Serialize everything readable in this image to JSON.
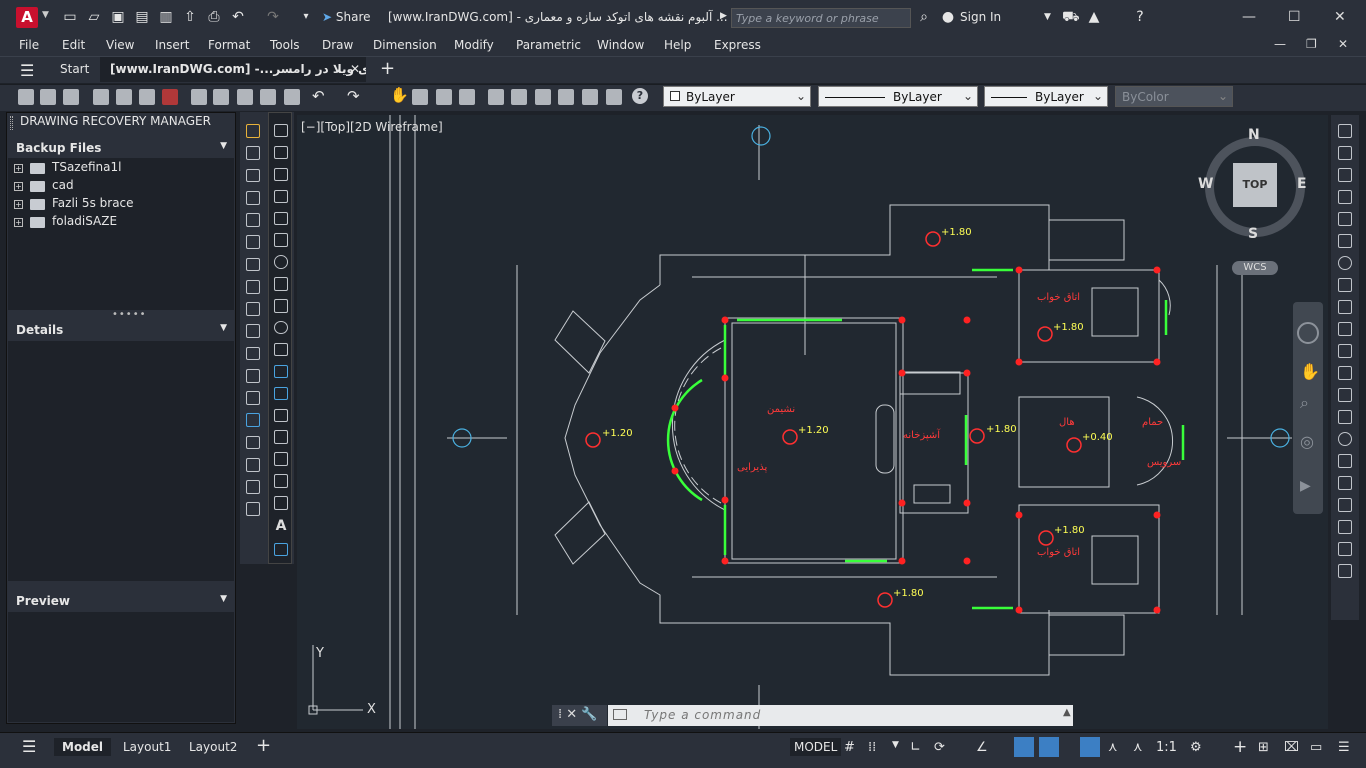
{
  "title_bar": {
    "logo": "A",
    "share_label": "Share",
    "window_title": "[www.IranDWG.com] - آلبوم نقشه های اتوکد سازه و معماری ...",
    "search_placeholder": "Type a keyword or phrase",
    "sign_in": "Sign In"
  },
  "menu": [
    "File",
    "Edit",
    "View",
    "Insert",
    "Format",
    "Tools",
    "Draw",
    "Dimension",
    "Modify",
    "Parametric",
    "Window",
    "Help",
    "Express"
  ],
  "tabs": {
    "start": "Start",
    "doc": "[www.IranDWG.com] -...مارى ويلا در رامسر*"
  },
  "properties": {
    "color": "ByLayer",
    "linetype": "ByLayer",
    "lineweight": "ByLayer",
    "plotstyle": "ByColor"
  },
  "recovery": {
    "title": "DRAWING RECOVERY MANAGER",
    "backup_label": "Backup Files",
    "files": [
      "TSazefina1l",
      "cad",
      "Fazli 5s brace",
      "foladiSAZE"
    ],
    "details_label": "Details",
    "preview_label": "Preview"
  },
  "view": {
    "label": "[−][Top][2D Wireframe]",
    "compass": {
      "n": "N",
      "s": "S",
      "e": "E",
      "w": "W",
      "top": "TOP"
    },
    "wcs": "WCS",
    "ucs_x": "X",
    "ucs_y": "Y"
  },
  "plan": {
    "elev_1": "+1.80",
    "elev_2": "+1.20",
    "elev_3": "+1.20",
    "elev_4": "+1.80",
    "elev_5": "+1.80",
    "elev_6": "+0.40",
    "elev_7": "+1.80",
    "elev_8": "+1.80",
    "room_living": "پذیرایی",
    "room_dining": "نشیمن",
    "room_kitchen": "آشپزخانه",
    "room_bed1": "اتاق خواب",
    "room_bed2": "اتاق خواب",
    "room_bath": "حمام",
    "room_wc": "سرویس",
    "room_hall": "هال"
  },
  "command": {
    "placeholder": "Type  a  command"
  },
  "layouts": [
    "Model",
    "Layout1",
    "Layout2"
  ],
  "status": {
    "model": "MODEL",
    "scale": "1:1"
  }
}
